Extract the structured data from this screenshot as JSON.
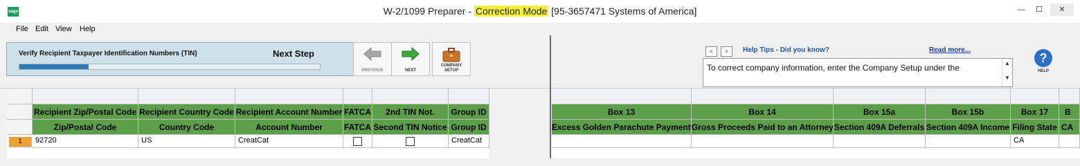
{
  "window": {
    "title_prefix": "W-2/1099 Preparer - ",
    "title_highlight": "Correction Mode",
    "title_suffix": " [95-3657471 Systems of America]",
    "app_icon": "sage",
    "buttons": {
      "minimize": "—",
      "maximize": "☐",
      "close": "✕"
    }
  },
  "menu": [
    "File",
    "Edit",
    "View",
    "Help"
  ],
  "wizard": {
    "step_title": "Verify Recipient Taxpayer Identification Numbers (TIN)",
    "next_label": "Next Step",
    "progress": 0.23
  },
  "toolbar": {
    "previous": "PREVIOUS",
    "next": "NEXT",
    "company_setup_1": "COMPANY",
    "company_setup_2": "SETUP"
  },
  "help_tips": {
    "prev": "<",
    "next": ">",
    "title": "Help Tips - Did you know?",
    "read_more": "Read more...",
    "text": "To correct company information, enter the Company Setup under the",
    "help_label": "HELP",
    "help_icon": "?"
  },
  "left_grid": {
    "headers_top": [
      "Recipient Zip/Postal Code",
      "Recipient Country Code",
      "Recipient Account Number",
      "FATCA",
      "2nd TIN Not.",
      "Group ID"
    ],
    "headers_bottom": [
      "Zip/Postal Code",
      "Country Code",
      "Account Number",
      "FATCA",
      "Second TIN Notice",
      "Group ID"
    ],
    "rows": [
      {
        "row_num": "1",
        "zip": "92720",
        "country": "US",
        "account": "CreatCat",
        "fatca": false,
        "second_tin": false,
        "group": "CreatCat"
      }
    ]
  },
  "right_grid": {
    "headers_top": [
      "Box 13",
      "Box 14",
      "Box 15a",
      "Box 15b",
      "Box 17",
      "B"
    ],
    "headers_bottom": [
      "Excess Golden Parachute Payments",
      "Gross Proceeds Paid to an Attorney",
      "Section 409A Deferrals",
      "Section 409A Income",
      "Filing State",
      "CA"
    ],
    "rows": [
      {
        "box13": "",
        "box14": "",
        "box15a": "",
        "box15b": "",
        "box17": "CA",
        "extra": ""
      }
    ]
  },
  "colors": {
    "header_green": "#5d9e4a",
    "highlight_yellow": "#f6f23a",
    "selected_row": "#f0a030"
  }
}
